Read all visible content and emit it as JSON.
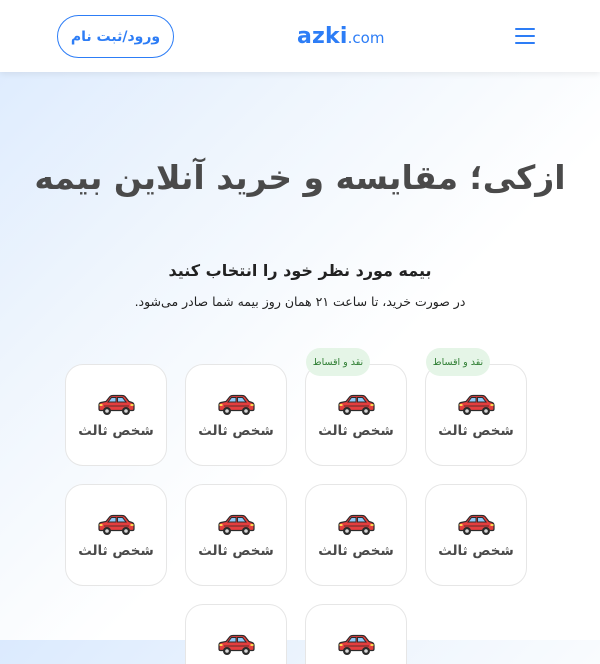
{
  "header": {
    "login_label": "ورود/ثبت نام",
    "logo_brand": "azki",
    "logo_tld": ".com",
    "menu_icon": "hamburger-menu-icon"
  },
  "hero": {
    "title": "ازکی؛ مقایسه و خرید آنلاین بیمه",
    "subtitle": "بیمه مورد نظر خود را انتخاب کنید",
    "note": "در صورت خرید، تا ساعت ۲۱ همان روز بیمه شما صادر می‌شود."
  },
  "colors": {
    "accent": "#2d7df6",
    "badge_bg": "#e5f5e7",
    "badge_text": "#2e7d32",
    "car_body": "#e53e3e"
  },
  "products": [
    {
      "label": "شخص ثالث",
      "icon": "car-icon",
      "badge": "نقد و اقساط"
    },
    {
      "label": "شخص ثالث",
      "icon": "car-icon",
      "badge": "نقد و اقساط"
    },
    {
      "label": "شخص ثالث",
      "icon": "car-icon",
      "badge": ""
    },
    {
      "label": "شخص ثالث",
      "icon": "car-icon",
      "badge": ""
    },
    {
      "label": "شخص ثالث",
      "icon": "car-icon",
      "badge": ""
    },
    {
      "label": "شخص ثالث",
      "icon": "car-icon",
      "badge": ""
    },
    {
      "label": "شخص ثالث",
      "icon": "car-icon",
      "badge": ""
    },
    {
      "label": "شخص ثالث",
      "icon": "car-icon",
      "badge": ""
    },
    {
      "label": "",
      "icon": "car-icon",
      "badge": ""
    },
    {
      "label": "",
      "icon": "car-icon",
      "badge": ""
    }
  ]
}
